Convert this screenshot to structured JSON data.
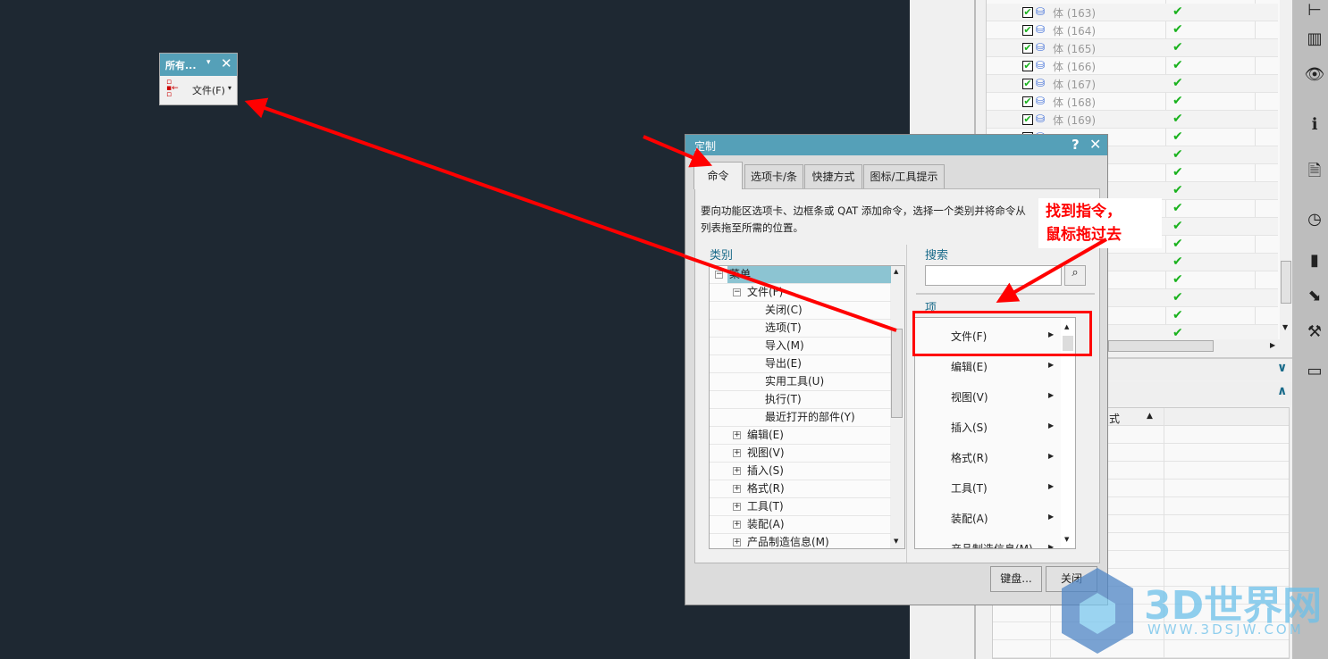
{
  "floating_toolbar": {
    "title": "所有...",
    "item_label": "文件(F)",
    "icons": [
      "tree-arrow-icon",
      "dropdown-icon",
      "close-icon"
    ]
  },
  "dialog": {
    "title": "定制",
    "help": "?",
    "close": "✕",
    "tabs": [
      {
        "label": "命令",
        "active": true
      },
      {
        "label": "选项卡/条"
      },
      {
        "label": "快捷方式"
      },
      {
        "label": "图标/工具提示"
      }
    ],
    "description_line1": "要向功能区选项卡、边框条或 QAT 添加命令，选择一个类别并将命令从",
    "description_line2": "列表拖至所需的位置。",
    "category_label": "类别",
    "tree": [
      {
        "label": "菜单",
        "level": 0,
        "expander": "−",
        "selected": true
      },
      {
        "label": "文件(F)",
        "level": 1,
        "expander": "−"
      },
      {
        "label": "关闭(C)",
        "level": 2
      },
      {
        "label": "选项(T)",
        "level": 2
      },
      {
        "label": "导入(M)",
        "level": 2
      },
      {
        "label": "导出(E)",
        "level": 2
      },
      {
        "label": "实用工具(U)",
        "level": 2
      },
      {
        "label": "执行(T)",
        "level": 2
      },
      {
        "label": "最近打开的部件(Y)",
        "level": 2
      },
      {
        "label": "编辑(E)",
        "level": 1,
        "expander": "+"
      },
      {
        "label": "视图(V)",
        "level": 1,
        "expander": "+"
      },
      {
        "label": "插入(S)",
        "level": 1,
        "expander": "+"
      },
      {
        "label": "格式(R)",
        "level": 1,
        "expander": "+"
      },
      {
        "label": "工具(T)",
        "level": 1,
        "expander": "+"
      },
      {
        "label": "装配(A)",
        "level": 1,
        "expander": "+"
      },
      {
        "label": "产品制造信息(M)",
        "level": 1,
        "expander": "+"
      }
    ],
    "search_label": "搜索",
    "search_value": "",
    "items_label": "项",
    "items": [
      "文件(F)",
      "编辑(E)",
      "视图(V)",
      "插入(S)",
      "格式(R)",
      "工具(T)",
      "装配(A)",
      "产品制造信息(M)"
    ],
    "buttons": {
      "keyboard": "键盘...",
      "close": "关闭"
    }
  },
  "annotation": {
    "line1": "找到指令，",
    "line2": "鼠标拖过去",
    "color": "#ff0000"
  },
  "right_panel": {
    "rows": [
      {
        "label": "体 (163)"
      },
      {
        "label": "体 (164)"
      },
      {
        "label": "体 (165)"
      },
      {
        "label": "体 (166)"
      },
      {
        "label": "体 (167)"
      },
      {
        "label": "体 (168)"
      },
      {
        "label": "体 (169)"
      },
      {
        "label": ""
      },
      {
        "label": ""
      },
      {
        "label": ""
      },
      {
        "label": ""
      },
      {
        "label": ""
      },
      {
        "label": ""
      },
      {
        "label": ""
      },
      {
        "label": ""
      },
      {
        "label": ""
      },
      {
        "label": ""
      },
      {
        "label": ""
      },
      {
        "label": ""
      }
    ],
    "bottom_header": "式"
  },
  "side_icons": [
    "constraint-icon",
    "library-icon",
    "eye-icon",
    "info-icon",
    "document-icon",
    "clock-icon",
    "color-palette-icon",
    "selection-icon",
    "tools-icon",
    "new-window-icon"
  ],
  "watermark": {
    "text": "3D世界网",
    "url_text": "WWW.3DSJW.COM"
  },
  "colors": {
    "title_bar": "#55a0b8",
    "background": "#1e2832",
    "arrow": "#ff0000"
  }
}
